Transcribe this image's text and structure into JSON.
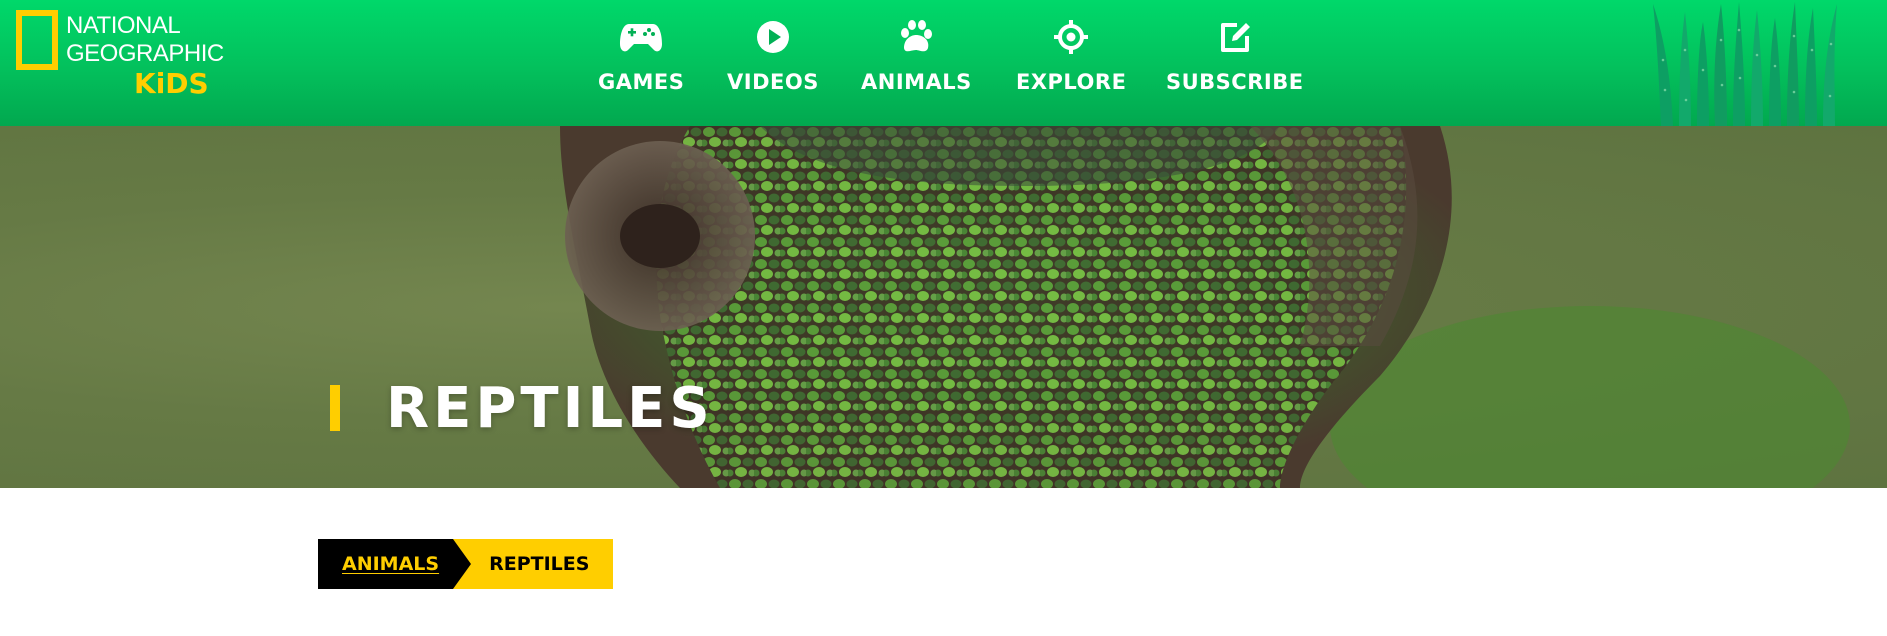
{
  "logo": {
    "line1": "NATIONAL",
    "line2": "GEOGRAPHIC",
    "line3": "KiDS"
  },
  "nav": {
    "items": [
      {
        "label": "GAMES",
        "icon": "gamepad-icon"
      },
      {
        "label": "VIDEOS",
        "icon": "play-icon"
      },
      {
        "label": "ANIMALS",
        "icon": "paw-icon"
      },
      {
        "label": "EXPLORE",
        "icon": "crosshair-icon"
      },
      {
        "label": "SUBSCRIBE",
        "icon": "edit-icon"
      }
    ]
  },
  "hero": {
    "title": "REPTILES"
  },
  "breadcrumb": {
    "parent": "ANIMALS",
    "current": "REPTILES"
  },
  "colors": {
    "header_green": "#00d86a",
    "accent_yellow": "#ffce00",
    "breadcrumb_black": "#000000"
  }
}
